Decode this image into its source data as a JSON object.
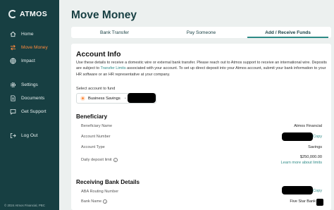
{
  "brand": {
    "name": "ATMOS"
  },
  "sidebar": {
    "items": [
      {
        "label": "Home",
        "icon": "home-icon"
      },
      {
        "label": "Move Money",
        "icon": "transfer-arrows-icon",
        "active": true
      },
      {
        "label": "Impact",
        "icon": "globe-icon"
      },
      {
        "label": "Settings",
        "icon": "gear-icon"
      },
      {
        "label": "Documents",
        "icon": "document-icon"
      },
      {
        "label": "Get Support",
        "icon": "chat-bubble-icon"
      },
      {
        "label": "Log Out",
        "icon": "logout-icon"
      }
    ],
    "footer": "© 2024 Atmos Financial, PBC"
  },
  "page": {
    "title": "Move Money"
  },
  "tabs": [
    {
      "label": "Bank Transfer"
    },
    {
      "label": "Pay Someone"
    },
    {
      "label": "Add / Receive Funds",
      "active": true
    }
  ],
  "account_info": {
    "title": "Account Info",
    "desc_part1": "Use these details to receive a domestic wire or external bank transfer. Please reach out to Atmos support to receive an international wire. Deposits are subject to",
    "desc_link": "Transfer Limits",
    "desc_part2": "associated with your account. To set up direct deposit into your Atmos account, submit your bank information to your HR software or an HR representative at your company.",
    "select_label": "Select account to fund",
    "selected_account": "Business Savings",
    "selected_sep": "•"
  },
  "beneficiary": {
    "title": "Beneficiary",
    "name_label": "Beneficiary Name",
    "name_value": "Atmos Financial",
    "account_number_label": "Account Number",
    "copy_label": "Copy",
    "account_type_label": "Account Type",
    "account_type_value": "Savings",
    "daily_limit_label": "Daily deposit limit",
    "daily_limit_value": "$250,000.00",
    "limits_link": "Learn more about limits"
  },
  "receiving_bank": {
    "title": "Receiving Bank Details",
    "aba_label": "ABA Routing Number",
    "copy_label": "Copy",
    "bank_name_label": "Bank Name",
    "bank_name_value": "Five Star Bank"
  },
  "colors": {
    "sidebar": "#173f42",
    "accent": "#ff8a3d",
    "link": "#2d8a86"
  }
}
